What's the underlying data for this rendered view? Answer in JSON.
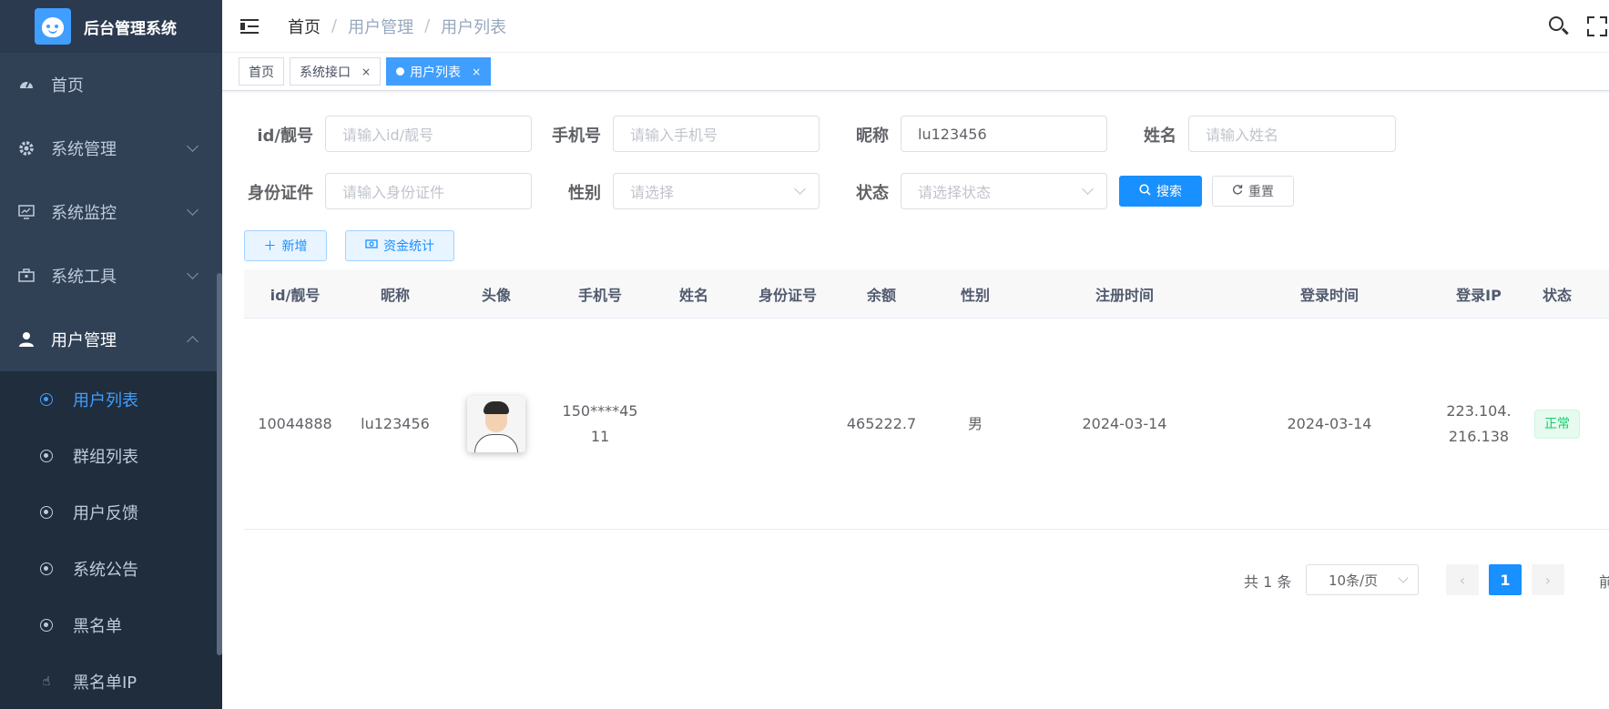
{
  "app": {
    "title": "后台管理系统"
  },
  "sidebar": {
    "items": [
      {
        "label": "首页",
        "icon": "dashboard-icon"
      },
      {
        "label": "系统管理",
        "icon": "gear-icon"
      },
      {
        "label": "系统监控",
        "icon": "monitor-icon"
      },
      {
        "label": "系统工具",
        "icon": "toolbox-icon"
      },
      {
        "label": "用户管理",
        "icon": "user-icon"
      }
    ],
    "subitems": [
      {
        "label": "用户列表"
      },
      {
        "label": "群组列表"
      },
      {
        "label": "用户反馈"
      },
      {
        "label": "系统公告"
      },
      {
        "label": "黑名单"
      },
      {
        "label": "黑名单IP"
      }
    ]
  },
  "breadcrumb": {
    "home": "首页",
    "sep": "/",
    "level1": "用户管理",
    "level2": "用户列表"
  },
  "tags": [
    {
      "label": "首页"
    },
    {
      "label": "系统接口",
      "close": "×"
    },
    {
      "label": "用户列表",
      "close": "×"
    }
  ],
  "form": {
    "id_label": "id/靓号",
    "id_placeholder": "请输入id/靓号",
    "phone_label": "手机号",
    "phone_placeholder": "请输入手机号",
    "nickname_label": "昵称",
    "nickname_value": "lu123456",
    "name_label": "姓名",
    "name_placeholder": "请输入姓名",
    "idcard_label": "身份证件",
    "idcard_placeholder": "请输入身份证件",
    "gender_label": "性别",
    "gender_placeholder": "请选择",
    "status_label": "状态",
    "status_placeholder": "请选择状态",
    "search_button": "搜索",
    "reset_button": "重置"
  },
  "toolbar": {
    "add_label": "新增",
    "funds_label": "资金统计"
  },
  "table": {
    "columns": [
      "id/靓号",
      "昵称",
      "头像",
      "手机号",
      "姓名",
      "身份证号",
      "余额",
      "性别",
      "注册时间",
      "登录时间",
      "登录IP",
      "状态"
    ],
    "rows": [
      {
        "id": "10044888",
        "nickname": "lu123456",
        "phone_line1": "150****45",
        "phone_line2": "11",
        "name": "",
        "idcard": "",
        "balance": "465222.7",
        "gender": "男",
        "register_time": "2024-03-14",
        "login_time": "2024-03-14",
        "ip_line1": "223.104.",
        "ip_line2": "216.138",
        "status": "正常"
      }
    ]
  },
  "pagination": {
    "total": "共 1 条",
    "page_size": "10条/页",
    "current_page": "1",
    "goto": "前"
  },
  "colors": {
    "primary": "#1890ff",
    "sidebar_bg": "#304156",
    "submenu_bg": "#1f2d3d",
    "success": "#13ce66"
  }
}
